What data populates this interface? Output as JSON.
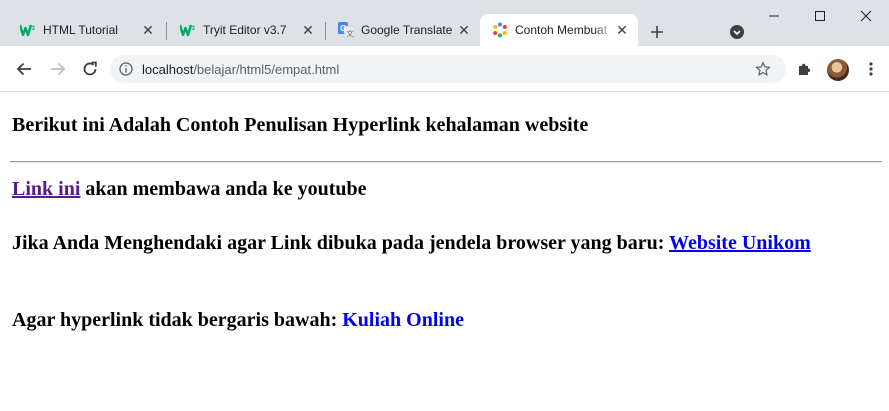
{
  "browser": {
    "tabs": [
      {
        "label": "HTML Tutorial",
        "icon": "w3schools-icon"
      },
      {
        "label": "Tryit Editor v3.7",
        "icon": "w3schools-icon"
      },
      {
        "label": "Google Translate",
        "icon": "google-translate-icon"
      },
      {
        "label": "Contoh Membuat",
        "icon": "loading-spinner-icon",
        "active": true
      }
    ],
    "address": {
      "host": "localhost",
      "path": "/belajar/html5/empat.html"
    },
    "colors": {
      "tab_strip": "#dee1e6",
      "w3schools_green": "#04aa6d",
      "translate_blue": "#4285f4"
    }
  },
  "page": {
    "heading": "Berikut ini Adalah Contoh Penulisan Hyperlink kehalaman website",
    "p1": {
      "link": "Link ini",
      "text": " akan membawa anda ke youtube"
    },
    "p2": {
      "text": "Jika Anda Menghendaki agar Link dibuka pada jendela browser yang baru: ",
      "link": "Website Unikom"
    },
    "p3": {
      "text": "Agar hyperlink tidak bergaris bawah: ",
      "link": "Kuliah Online"
    },
    "colors": {
      "visited_link": "#551a8b",
      "link": "#0000ee"
    }
  }
}
